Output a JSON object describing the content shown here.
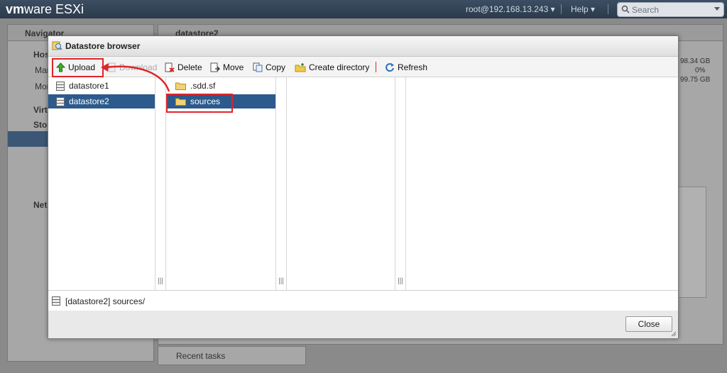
{
  "app": {
    "brand_vm": "vm",
    "brand_ware": "ware",
    "brand_esxi": " ESXi",
    "user": "root@192.168.13.243 ▾",
    "help": "Help ▾",
    "search_placeholder": "Search"
  },
  "background": {
    "navigator_title": "Navigator",
    "datastore_title": "datastore2",
    "nav_host": "Hos",
    "nav_man": "Mar",
    "nav_mon": "Mon",
    "nav_virt": "Virt",
    "nav_stor": "Stor",
    "nav_net": "Net",
    "cap1": "98.34 GB",
    "cap2": "0%",
    "cap3": "99.75 GB",
    "recent_tasks": "Recent tasks"
  },
  "dialog": {
    "title": "Datastore browser",
    "toolbar": {
      "upload": "Upload",
      "download": "Download",
      "delete": "Delete",
      "move": "Move",
      "copy": "Copy",
      "create_directory": "Create directory",
      "refresh": "Refresh"
    },
    "datastores": [
      "datastore1",
      "datastore2"
    ],
    "folders": [
      ".sdd.sf",
      "sources"
    ],
    "status_path": "[datastore2] sources/",
    "close": "Close"
  },
  "colors": {
    "selection": "#2c5a8c",
    "highlight": "#e0242b"
  }
}
